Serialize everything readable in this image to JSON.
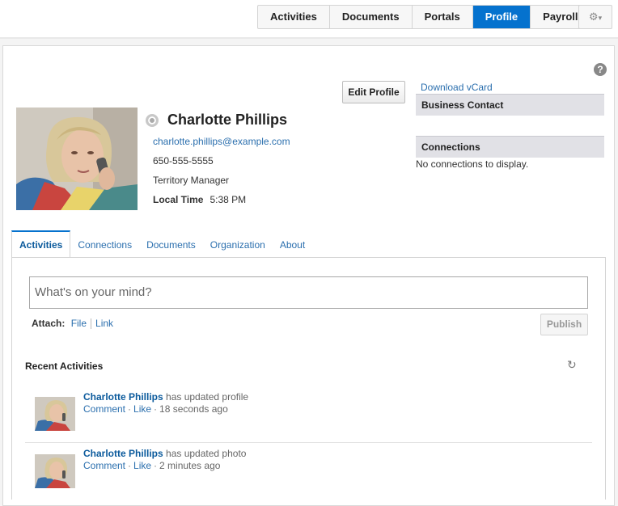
{
  "nav": {
    "tabs": [
      "Activities",
      "Documents",
      "Portals",
      "Profile",
      "Payroll"
    ],
    "active": "Profile",
    "settings_icon": "gear-icon",
    "settings_caret": "▾"
  },
  "help": {
    "icon": "question-icon",
    "glyph": "?"
  },
  "profile": {
    "edit_label": "Edit Profile",
    "name": "Charlotte Phillips",
    "email": "charlotte.phillips@example.com",
    "phone": "650-555-5555",
    "job_title": "Territory Manager",
    "local_time_label": "Local Time",
    "local_time": "5:38 PM"
  },
  "sidebar": {
    "vcard": "Download vCard",
    "business_contact": "Business Contact",
    "connections": "Connections",
    "no_connections": "No connections to display."
  },
  "profile_tabs": [
    "Activities",
    "Connections",
    "Documents",
    "Organization",
    "About"
  ],
  "composer": {
    "placeholder": "What's on your mind?",
    "attach_label": "Attach:",
    "attach_file": "File",
    "attach_link": "Link",
    "publish": "Publish"
  },
  "recent": {
    "heading": "Recent Activities",
    "refresh_icon": "refresh-icon",
    "items": [
      {
        "who": "Charlotte Phillips",
        "what": "has updated profile",
        "comment": "Comment",
        "like": "Like",
        "time": "18 seconds ago"
      },
      {
        "who": "Charlotte Phillips",
        "what": "has updated photo",
        "comment": "Comment",
        "like": "Like",
        "time": "2 minutes ago"
      }
    ]
  },
  "colors": {
    "accent": "#0572ce",
    "link": "#2b6fae",
    "section_bg": "#e1e1e6"
  }
}
